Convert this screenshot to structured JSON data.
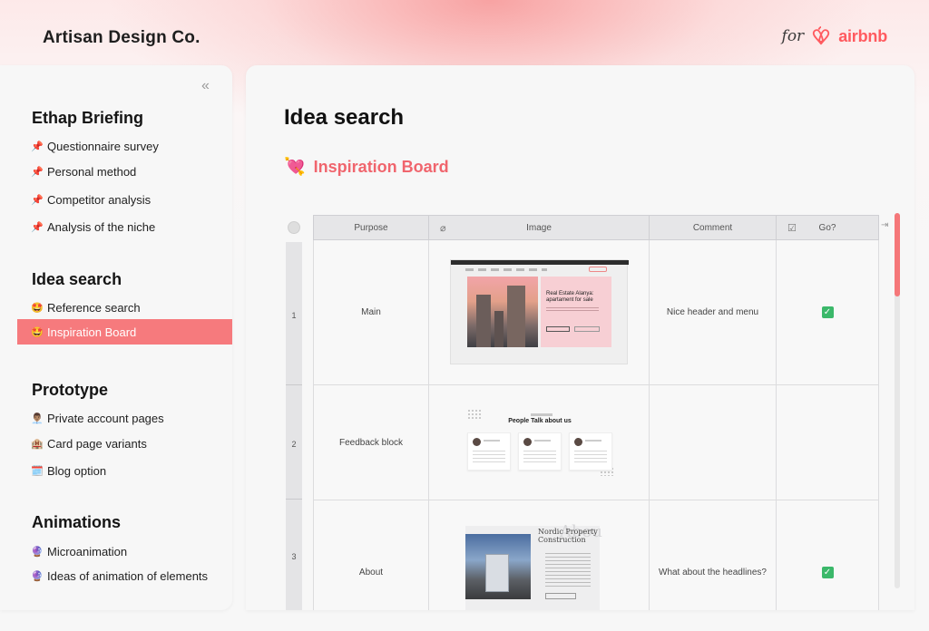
{
  "brand": "Artisan Design Co.",
  "partner": {
    "for_text": "for",
    "wordmark": "airbnb"
  },
  "sidebar": {
    "sections": [
      {
        "title": "Ethap Briefing",
        "items": [
          {
            "icon": "📌",
            "label": "Questionnaire survey"
          },
          {
            "icon": "📌",
            "label": "Personal method"
          },
          {
            "icon": "📌",
            "label": "Competitor analysis"
          },
          {
            "icon": "📌",
            "label": "Analysis of the niche"
          }
        ]
      },
      {
        "title": "Idea search",
        "items": [
          {
            "icon": "🤩",
            "label": "Reference search"
          },
          {
            "icon": "🤩",
            "label": "Inspiration Board"
          }
        ]
      },
      {
        "title": "Prototype",
        "items": [
          {
            "icon": "👨🏽‍💼",
            "label": "Private account pages"
          },
          {
            "icon": "🏨",
            "label": "Card page variants"
          },
          {
            "icon": "🗓️",
            "label": "Blog option"
          }
        ]
      },
      {
        "title": "Animations",
        "items": [
          {
            "icon": "🔮",
            "label": "Microanimation"
          },
          {
            "icon": "🔮",
            "label": "Ideas of animation of elements"
          }
        ]
      }
    ],
    "active_item": "Inspiration Board",
    "collapse_glyph": "«"
  },
  "main": {
    "title": "Idea search",
    "board": {
      "emoji": "💘",
      "label": "Inspiration Board"
    }
  },
  "table": {
    "columns": [
      "Purpose",
      "Image",
      "Comment",
      "Go?"
    ],
    "rows": [
      {
        "num": "1",
        "purpose": "Main",
        "comment": "Nice header and menu",
        "go": true
      },
      {
        "num": "2",
        "purpose": "Feedback block",
        "comment": "",
        "go": false
      },
      {
        "num": "3",
        "purpose": "About",
        "comment": "What about the headlines?",
        "go": true
      }
    ],
    "thumb_main": {
      "heading": "Real Estate Alanya: apartament for sale"
    },
    "thumb_feedback": {
      "heading": "People Talk about us"
    },
    "thumb_about": {
      "heading": "Nordic Property Construction",
      "watermark": "Abou"
    }
  },
  "colors": {
    "accent": "#f67a7d",
    "airbnb": "#ff5a5f",
    "check": "#3bb86a"
  },
  "icons": {
    "paperclip": "attachment-icon",
    "checkbox": "checkbox-icon",
    "expand": "expand-column-icon"
  }
}
